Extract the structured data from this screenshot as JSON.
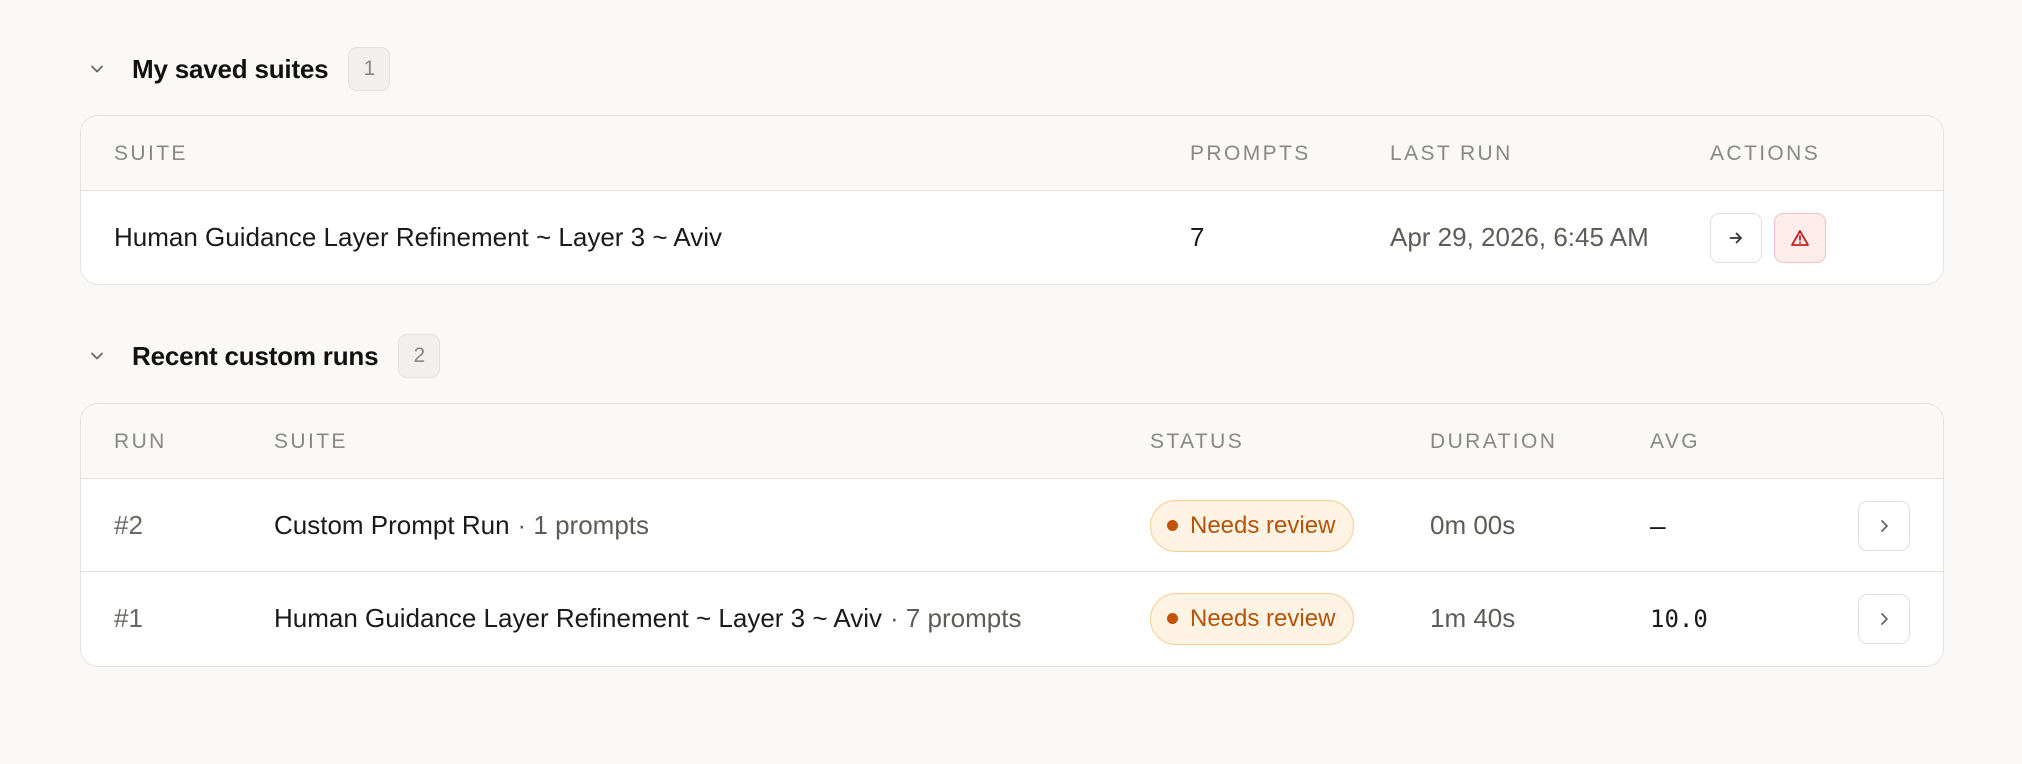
{
  "saved_suites": {
    "title": "My saved suites",
    "count": "1",
    "columns": {
      "suite": "SUITE",
      "prompts": "PROMPTS",
      "last_run": "LAST RUN",
      "actions": "ACTIONS"
    },
    "rows": [
      {
        "suite": "Human Guidance Layer Refinement ~ Layer 3 ~ Aviv",
        "prompts": "7",
        "last_run": "Apr 29, 2026, 6:45 AM"
      }
    ]
  },
  "recent_runs": {
    "title": "Recent custom runs",
    "count": "2",
    "columns": {
      "run": "RUN",
      "suite": "SUITE",
      "status": "STATUS",
      "duration": "DURATION",
      "avg": "AVG"
    },
    "rows": [
      {
        "run": "#2",
        "suite": "Custom Prompt Run",
        "meta": "· 1 prompts",
        "status": "Needs review",
        "duration": "0m 00s",
        "avg": "–"
      },
      {
        "run": "#1",
        "suite": "Human Guidance Layer Refinement ~ Layer 3 ~ Aviv",
        "meta": "· 7 prompts",
        "status": "Needs review",
        "duration": "1m 40s",
        "avg": "10.0"
      }
    ]
  },
  "colors": {
    "background": "#faf9f7",
    "status_text": "#b45309",
    "status_bg": "#fff3e3",
    "danger": "#c81e1e"
  },
  "icons": {
    "collapse": "chevron-down-icon",
    "run_suite": "arrow-right-icon",
    "delete_suite": "warning-triangle-icon",
    "open_run": "chevron-right-icon"
  }
}
